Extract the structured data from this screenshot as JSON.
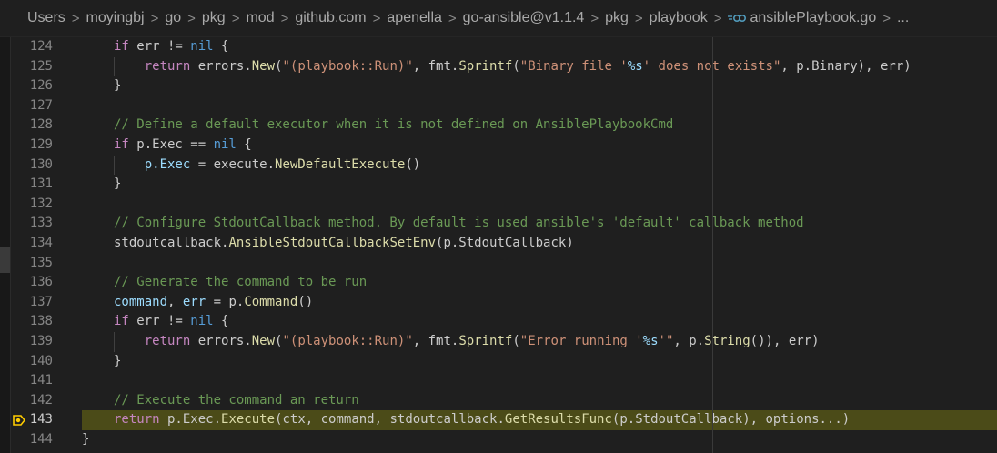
{
  "breadcrumb": {
    "items": [
      "Users",
      "moyingbj",
      "go",
      "pkg",
      "mod",
      "github.com",
      "apenella",
      "go-ansible@v1.1.4",
      "pkg",
      "playbook",
      "ansiblePlaybook.go",
      "..."
    ],
    "separator": ">"
  },
  "editor": {
    "active_line": 143,
    "lines": [
      {
        "n": "124",
        "indent": 1,
        "tokens": [
          [
            "kw",
            "if"
          ],
          [
            "pl",
            " err != "
          ],
          [
            "kw2",
            "nil"
          ],
          [
            "pl",
            " {"
          ]
        ]
      },
      {
        "n": "125",
        "indent": 2,
        "tokens": [
          [
            "kw",
            "return"
          ],
          [
            "pl",
            " errors."
          ],
          [
            "fn",
            "New"
          ],
          [
            "pl",
            "("
          ],
          [
            "str",
            "\"(playbook::Run)\""
          ],
          [
            "pl",
            ", fmt."
          ],
          [
            "fn",
            "Sprintf"
          ],
          [
            "pl",
            "("
          ],
          [
            "str",
            "\"Binary file '"
          ],
          [
            "fmt",
            "%s"
          ],
          [
            "str",
            "' does not exists\""
          ],
          [
            "pl",
            ", p.Binary), err)"
          ]
        ]
      },
      {
        "n": "126",
        "indent": 1,
        "tokens": [
          [
            "pl",
            "}"
          ]
        ]
      },
      {
        "n": "127",
        "indent": 0,
        "tokens": []
      },
      {
        "n": "128",
        "indent": 1,
        "tokens": [
          [
            "cm",
            "// Define a default executor when it is not defined on AnsiblePlaybookCmd"
          ]
        ]
      },
      {
        "n": "129",
        "indent": 1,
        "tokens": [
          [
            "kw",
            "if"
          ],
          [
            "pl",
            " p.Exec == "
          ],
          [
            "kw2",
            "nil"
          ],
          [
            "pl",
            " {"
          ]
        ]
      },
      {
        "n": "130",
        "indent": 2,
        "tokens": [
          [
            "var",
            "p.Exec"
          ],
          [
            "pl",
            " = execute."
          ],
          [
            "fn",
            "NewDefaultExecute"
          ],
          [
            "pl",
            "()"
          ]
        ]
      },
      {
        "n": "131",
        "indent": 1,
        "tokens": [
          [
            "pl",
            "}"
          ]
        ]
      },
      {
        "n": "132",
        "indent": 0,
        "tokens": []
      },
      {
        "n": "133",
        "indent": 1,
        "tokens": [
          [
            "cm",
            "// Configure StdoutCallback method. By default is used ansible's 'default' callback method"
          ]
        ]
      },
      {
        "n": "134",
        "indent": 1,
        "tokens": [
          [
            "pl",
            "stdoutcallback."
          ],
          [
            "fn",
            "AnsibleStdoutCallbackSetEnv"
          ],
          [
            "pl",
            "(p.StdoutCallback)"
          ]
        ]
      },
      {
        "n": "135",
        "indent": 0,
        "tokens": []
      },
      {
        "n": "136",
        "indent": 1,
        "tokens": [
          [
            "cm",
            "// Generate the command to be run"
          ]
        ]
      },
      {
        "n": "137",
        "indent": 1,
        "tokens": [
          [
            "var",
            "command"
          ],
          [
            "pl",
            ", "
          ],
          [
            "var",
            "err"
          ],
          [
            "pl",
            " = p."
          ],
          [
            "fn",
            "Command"
          ],
          [
            "pl",
            "()"
          ]
        ]
      },
      {
        "n": "138",
        "indent": 1,
        "tokens": [
          [
            "kw",
            "if"
          ],
          [
            "pl",
            " err != "
          ],
          [
            "kw2",
            "nil"
          ],
          [
            "pl",
            " {"
          ]
        ]
      },
      {
        "n": "139",
        "indent": 2,
        "tokens": [
          [
            "kw",
            "return"
          ],
          [
            "pl",
            " errors."
          ],
          [
            "fn",
            "New"
          ],
          [
            "pl",
            "("
          ],
          [
            "str",
            "\"(playbook::Run)\""
          ],
          [
            "pl",
            ", fmt."
          ],
          [
            "fn",
            "Sprintf"
          ],
          [
            "pl",
            "("
          ],
          [
            "str",
            "\"Error running '"
          ],
          [
            "fmt",
            "%s"
          ],
          [
            "str",
            "'\""
          ],
          [
            "pl",
            ", p."
          ],
          [
            "fn",
            "String"
          ],
          [
            "pl",
            "()), err)"
          ]
        ]
      },
      {
        "n": "140",
        "indent": 1,
        "tokens": [
          [
            "pl",
            "}"
          ]
        ]
      },
      {
        "n": "141",
        "indent": 0,
        "tokens": []
      },
      {
        "n": "142",
        "indent": 1,
        "tokens": [
          [
            "cm",
            "// Execute the command an return"
          ]
        ]
      },
      {
        "n": "143",
        "indent": 1,
        "tokens": [
          [
            "kw",
            "return"
          ],
          [
            "pl",
            " p.Exec."
          ],
          [
            "fn",
            "Execute"
          ],
          [
            "pl",
            "(ctx, command, stdoutcallback."
          ],
          [
            "fn",
            "GetResultsFunc"
          ],
          [
            "pl",
            "(p.StdoutCallback), options...)"
          ]
        ]
      },
      {
        "n": "144",
        "indent": 0,
        "tokens": [
          [
            "pl",
            "}"
          ]
        ]
      }
    ]
  },
  "colors": {
    "background": "#1f1f1f",
    "highlight_line": "#4b4b18",
    "breakpoint": "#ffcc00",
    "keyword": "#c586c0",
    "constant": "#569cd6",
    "string": "#ce9178",
    "function": "#dcdcaa",
    "comment": "#6a9955",
    "variable": "#9cdcfe"
  },
  "icons": {
    "breadcrumb_file": "go-file-icon",
    "breakpoint": "debug-breakpoint-current-icon"
  }
}
